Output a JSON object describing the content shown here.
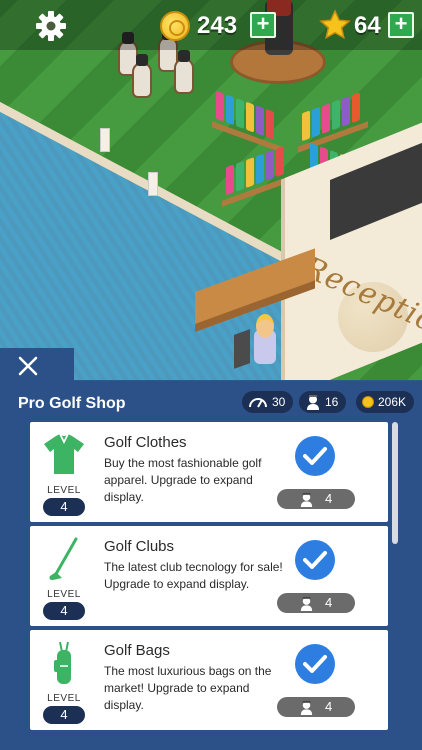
{
  "hud": {
    "coins": "243",
    "stars": "64",
    "plus": "+"
  },
  "scene": {
    "sign_text": "Reception"
  },
  "panel": {
    "close": "close",
    "title": "Pro Golf Shop",
    "stats": {
      "speed": "30",
      "staff": "16",
      "income": "206K"
    }
  },
  "items": [
    {
      "name": "Golf Clothes",
      "description": "Buy the most fashionable golf apparel. Upgrade to expand display.",
      "level_label": "LEVEL",
      "level": "4",
      "staff": "4",
      "icon": "shirt-icon",
      "completed": true
    },
    {
      "name": "Golf Clubs",
      "description": "The latest club tecnology for sale! Upgrade to expand display.",
      "level_label": "LEVEL",
      "level": "4",
      "staff": "4",
      "icon": "golf-club-icon",
      "completed": true
    },
    {
      "name": "Golf Bags",
      "description": "The most luxurious bags on the market! Upgrade to expand display.",
      "level_label": "LEVEL",
      "level": "4",
      "staff": "4",
      "icon": "golf-bag-icon",
      "completed": true
    }
  ],
  "colors": {
    "panel": "#2c5189",
    "pill_dark": "#1c2f54",
    "check_blue": "#2e7de0",
    "plus_green": "#2fa84f",
    "icon_green": "#3cb464"
  }
}
